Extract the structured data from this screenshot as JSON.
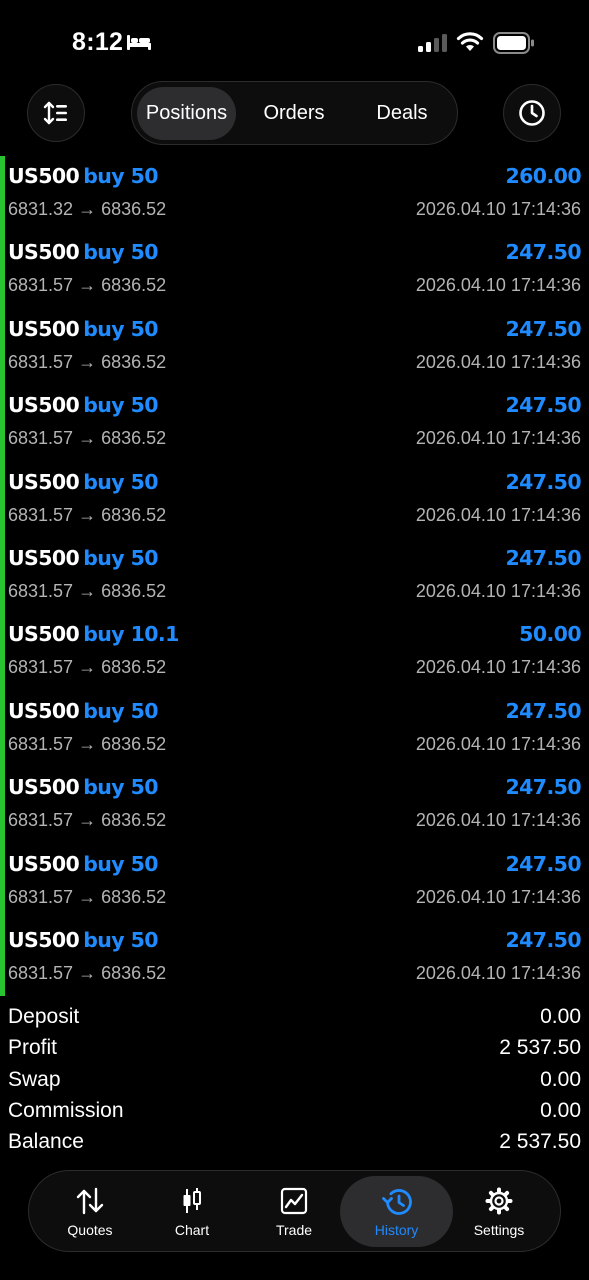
{
  "status_bar": {
    "time": "8:12"
  },
  "tabs": [
    {
      "label": "Positions"
    },
    {
      "label": "Orders"
    },
    {
      "label": "Deals"
    }
  ],
  "deals": [
    {
      "symbol": "US500",
      "side": "buy 50",
      "profit": "260.00",
      "prices": "6831.32 → 6836.52",
      "time": "2026.04.10 17:14:36"
    },
    {
      "symbol": "US500",
      "side": "buy 50",
      "profit": "247.50",
      "prices": "6831.57 → 6836.52",
      "time": "2026.04.10 17:14:36"
    },
    {
      "symbol": "US500",
      "side": "buy 50",
      "profit": "247.50",
      "prices": "6831.57 → 6836.52",
      "time": "2026.04.10 17:14:36"
    },
    {
      "symbol": "US500",
      "side": "buy 50",
      "profit": "247.50",
      "prices": "6831.57 → 6836.52",
      "time": "2026.04.10 17:14:36"
    },
    {
      "symbol": "US500",
      "side": "buy 50",
      "profit": "247.50",
      "prices": "6831.57 → 6836.52",
      "time": "2026.04.10 17:14:36"
    },
    {
      "symbol": "US500",
      "side": "buy 50",
      "profit": "247.50",
      "prices": "6831.57 → 6836.52",
      "time": "2026.04.10 17:14:36"
    },
    {
      "symbol": "US500",
      "side": "buy 10.1",
      "profit": "50.00",
      "prices": "6831.57 → 6836.52",
      "time": "2026.04.10 17:14:36"
    },
    {
      "symbol": "US500",
      "side": "buy 50",
      "profit": "247.50",
      "prices": "6831.57 → 6836.52",
      "time": "2026.04.10 17:14:36"
    },
    {
      "symbol": "US500",
      "side": "buy 50",
      "profit": "247.50",
      "prices": "6831.57 → 6836.52",
      "time": "2026.04.10 17:14:36"
    },
    {
      "symbol": "US500",
      "side": "buy 50",
      "profit": "247.50",
      "prices": "6831.57 → 6836.52",
      "time": "2026.04.10 17:14:36"
    },
    {
      "symbol": "US500",
      "side": "buy 50",
      "profit": "247.50",
      "prices": "6831.57 → 6836.52",
      "time": "2026.04.10 17:14:36"
    }
  ],
  "summary": [
    {
      "label": "Deposit",
      "value": "0.00"
    },
    {
      "label": "Profit",
      "value": "2 537.50"
    },
    {
      "label": "Swap",
      "value": "0.00"
    },
    {
      "label": "Commission",
      "value": "0.00"
    },
    {
      "label": "Balance",
      "value": "2 537.50"
    }
  ],
  "nav": [
    {
      "label": "Quotes",
      "icon": "quotes-arrows-icon"
    },
    {
      "label": "Chart",
      "icon": "candlestick-icon"
    },
    {
      "label": "Trade",
      "icon": "line-chart-icon"
    },
    {
      "label": "History",
      "icon": "history-clock-icon"
    },
    {
      "label": "Settings",
      "icon": "gear-icon"
    }
  ],
  "colors": {
    "accent": "#1f8bff",
    "profit_bar": "#29c431",
    "background": "#000000",
    "secondary_text": "#b4b4b4"
  }
}
